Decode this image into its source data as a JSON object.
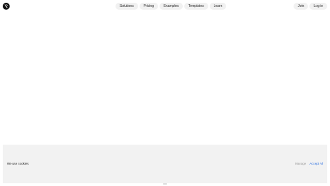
{
  "header": {
    "logo": "logo-icon",
    "nav": [
      {
        "label": "Solutions"
      },
      {
        "label": "Pricing"
      },
      {
        "label": "Examples"
      },
      {
        "label": "Templates"
      },
      {
        "label": "Learn"
      }
    ],
    "auth": {
      "join_label": "Join",
      "login_label": "Log in"
    }
  },
  "cookie_banner": {
    "text": "We use cookies",
    "manage_label": "Manage",
    "accept_label": "Accept All",
    "accent_color": "#2b6fe0",
    "background": "#f2f2f2"
  }
}
